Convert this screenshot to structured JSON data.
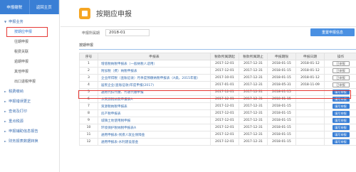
{
  "sidebar": {
    "top_buttons": [
      "申报缴税",
      "返回主页"
    ],
    "groups": [
      {
        "label": "申报业务",
        "items": [
          "按期应申报",
          "往期申报",
          "税费关联",
          "逾期申报",
          "其他申报",
          "出口退税申报"
        ]
      },
      {
        "label": "税费缴纳"
      },
      {
        "label": "申报错误更正"
      },
      {
        "label": "查询及打印"
      },
      {
        "label": "重点税源"
      },
      {
        "label": "申报辅助信息报告"
      },
      {
        "label": "财务报表数据转换"
      }
    ]
  },
  "header": {
    "title": "按期应申报"
  },
  "period": {
    "label": "申报所属期",
    "value": "2018-01"
  },
  "buttons": {
    "resubmit": "重置申报信息"
  },
  "section": {
    "label": "按期申报"
  },
  "table": {
    "headers": [
      "序号",
      "申报表",
      "税款所属期起",
      "税款所属期止",
      "申报期限",
      "申报日期",
      "操作"
    ],
    "rows": [
      {
        "no": "1",
        "name": "增值税纳税申报表（一般纳税人适用）",
        "start": "2017-12-01",
        "end": "2017-12-31",
        "deadline": "2018-01-15",
        "date": "2018-01-12",
        "op": "已申报",
        "op_style": "outline"
      },
      {
        "no": "2",
        "name": "附加税（费）纳税申报表",
        "start": "2017-12-01",
        "end": "2017-12-31",
        "deadline": "2018-01-15",
        "date": "2018-01-12",
        "op": "已申报",
        "op_style": "outline"
      },
      {
        "no": "3",
        "name": "企业所得税（查账征收）月季度预缴纳税申报表（A类，2015年版）",
        "start": "2017-10-01",
        "end": "2017-12-31",
        "deadline": "2018-01-15",
        "date": "2018-01-12",
        "op": "已申报",
        "op_style": "outline"
      },
      {
        "no": "4",
        "name": "居民企业(查账征收)年度申报(2017)",
        "start": "2017-01-01",
        "end": "2017-12-31",
        "deadline": "2018-05-31",
        "date": "2018-11-09",
        "op": "已申报",
        "op_style": "outline"
      },
      {
        "no": "5",
        "name": "通用代扣代缴、代收代缴申报",
        "start": "2017-12-01",
        "end": "2017-12-31",
        "deadline": "2018-01-15",
        "date": "",
        "op": "填写申报",
        "op_style": "fill"
      },
      {
        "no": "6",
        "name": "水资源税纳税申报表A",
        "start": "2017-12-01",
        "end": "2017-12-31",
        "deadline": "2018-01-15",
        "date": "",
        "op": "填写申报",
        "op_style": "fill"
      },
      {
        "no": "7",
        "name": "资源税纳税申报表",
        "start": "2017-12-01",
        "end": "2017-12-31",
        "deadline": "2018-01-15",
        "date": "",
        "op": "填写申报",
        "op_style": "fill"
      },
      {
        "no": "8",
        "name": "房产税申报表",
        "start": "2017-12-01",
        "end": "2017-12-31",
        "deadline": "2018-01-15",
        "date": "",
        "op": "填写申报",
        "op_style": "fill"
      },
      {
        "no": "9",
        "name": "城镇土地使用税申报",
        "start": "2017-12-01",
        "end": "2017-12-31",
        "deadline": "2018-01-15",
        "date": "",
        "op": "填写申报",
        "op_style": "fill"
      },
      {
        "no": "10",
        "name": "环境保护税纳税申报表A",
        "start": "2017-12-01",
        "end": "2017-12-31",
        "deadline": "2018-01-15",
        "date": "",
        "op": "填写申报",
        "op_style": "fill"
      },
      {
        "no": "11",
        "name": "通用申报表-残疾人就业保障金",
        "start": "2017-12-01",
        "end": "2017-12-31",
        "deadline": "2018-01-15",
        "date": "",
        "op": "填写申报",
        "op_style": "fill"
      },
      {
        "no": "12",
        "name": "通用申报表-水利建设基金",
        "start": "2017-12-01",
        "end": "2017-12-31",
        "deadline": "2018-01-15",
        "date": "",
        "op": "填写申报",
        "op_style": "fill"
      }
    ]
  }
}
